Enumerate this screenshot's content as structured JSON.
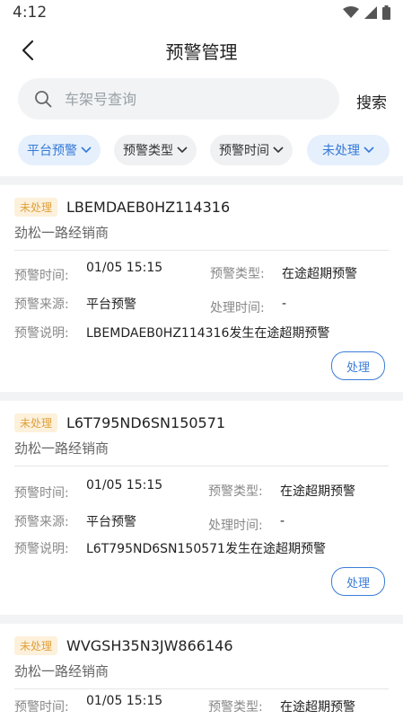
{
  "status_bar": {
    "time": "4:12"
  },
  "header": {
    "title": "预警管理"
  },
  "search": {
    "placeholder": "车架号查询",
    "button": "搜索"
  },
  "filters": [
    {
      "label": "平台预警",
      "active": true
    },
    {
      "label": "预警类型",
      "active": false
    },
    {
      "label": "预警时间",
      "active": false
    },
    {
      "label": "未处理",
      "active": true
    }
  ],
  "field_labels": {
    "time": "预警时间:",
    "type": "预警类型:",
    "source": "预警来源:",
    "handle_time": "处理时间:",
    "desc": "预警说明:"
  },
  "cards": [
    {
      "status": "未处理",
      "vin": "LBEMDAEB0HZ114316",
      "dealer": "劲松一路经销商",
      "alert_time": "01/05 15:15",
      "alert_type": "在途超期预警",
      "alert_source": "平台预警",
      "handle_time": "-",
      "desc": "LBEMDAEB0HZ114316发生在途超期预警",
      "action": "处理"
    },
    {
      "status": "未处理",
      "vin": "L6T795ND6SN150571",
      "dealer": "劲松一路经销商",
      "alert_time": "01/05 15:15",
      "alert_type": "在途超期预警",
      "alert_source": "平台预警",
      "handle_time": "-",
      "desc": "L6T795ND6SN150571发生在途超期预警",
      "action": "处理"
    },
    {
      "status": "未处理",
      "vin": "WVGSH35N3JW866146",
      "dealer": "劲松一路经销商",
      "alert_time": "01/05 15:15",
      "alert_type": "在途超期预警"
    }
  ],
  "colors": {
    "accent": "#3479d6",
    "badge_bg": "#fdf1dc",
    "badge_text": "#e0a03a"
  }
}
